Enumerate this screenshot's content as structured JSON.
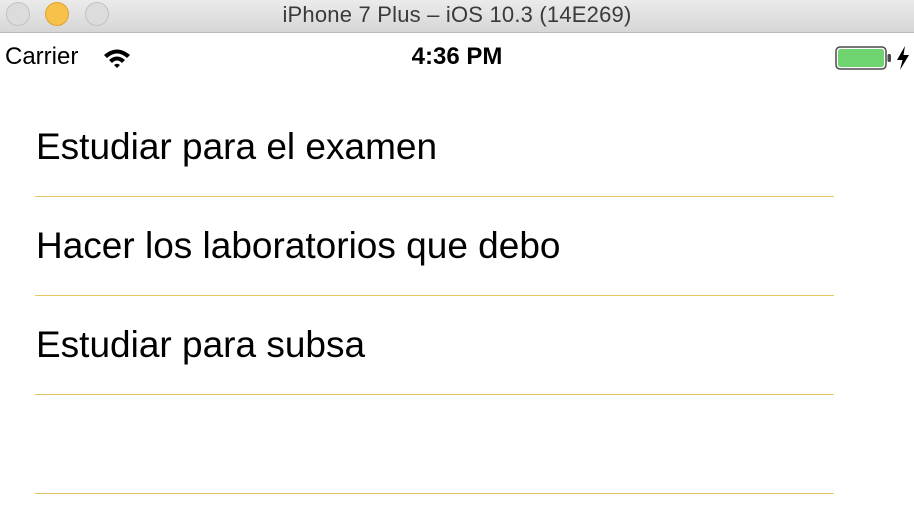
{
  "window": {
    "title": "iPhone 7 Plus – iOS 10.3 (14E269)",
    "controls": [
      "close",
      "minimize",
      "zoom"
    ]
  },
  "status_bar": {
    "carrier": "Carrier",
    "wifi_icon": "wifi-icon",
    "time": "4:36 PM",
    "battery_icon": "battery-icon",
    "battery_level": 1.0,
    "battery_color": "#6fd36f",
    "charging_icon": "bolt-icon"
  },
  "tasks": [
    {
      "label": "Estudiar para el examen"
    },
    {
      "label": "Hacer los laboratorios que debo"
    },
    {
      "label": "Estudiar para subsa"
    },
    {
      "label": ""
    }
  ],
  "colors": {
    "separator": "#e6c85f",
    "minimize_button": "#f8c14a"
  }
}
